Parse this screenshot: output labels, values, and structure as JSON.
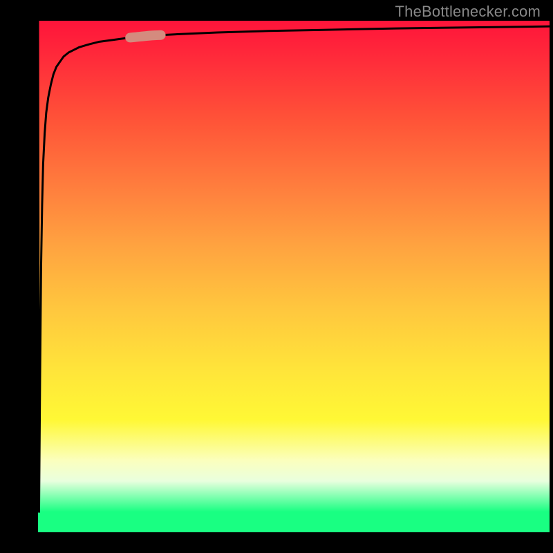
{
  "attribution": "TheBottlenecker.com",
  "chart_data": {
    "type": "line",
    "title": "",
    "xlabel": "",
    "ylabel": "",
    "xlim": [
      0,
      100
    ],
    "ylim": [
      0,
      100
    ],
    "x": [
      0,
      0.2,
      0.4,
      0.6,
      0.8,
      1.0,
      1.3,
      1.6,
      2.0,
      2.5,
      3.0,
      3.6,
      4.3,
      5.0,
      6.0,
      7.0,
      8.0,
      10.0,
      12.0,
      15.0,
      18.0,
      22.0,
      28.0,
      35.0,
      45.0,
      55.0,
      70.0,
      85.0,
      100.0
    ],
    "values": [
      100,
      4,
      30,
      52,
      64,
      72,
      78,
      82,
      85,
      87.5,
      89.5,
      91,
      92,
      93,
      93.8,
      94.3,
      94.8,
      95.4,
      95.9,
      96.3,
      96.7,
      97.1,
      97.4,
      97.7,
      98.0,
      98.2,
      98.5,
      98.7,
      98.9
    ],
    "annotations": [
      {
        "type": "highlight_segment",
        "x_start": 18,
        "x_end": 24,
        "color": "#d48b7e"
      }
    ],
    "background_gradient": {
      "direction": "vertical_top_to_bottom",
      "stops": [
        {
          "pos": 0.0,
          "color": "#ff143a"
        },
        {
          "pos": 0.5,
          "color": "#ffc63e"
        },
        {
          "pos": 0.78,
          "color": "#fff835"
        },
        {
          "pos": 0.95,
          "color": "#19ff82"
        }
      ]
    }
  }
}
